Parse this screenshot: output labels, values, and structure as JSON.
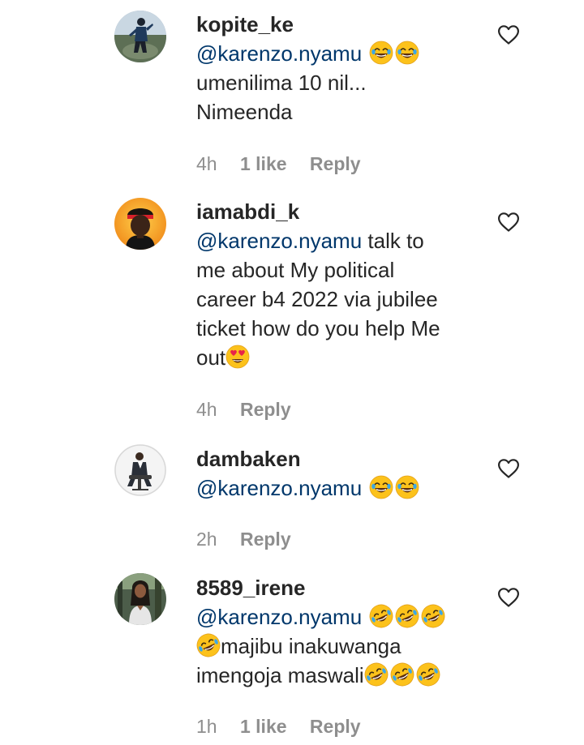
{
  "comments": [
    {
      "username": "kopite_ke",
      "mention": "@karenzo.nyamu",
      "lines": [
        "umenilima 10 nil...",
        "Nimeenda"
      ],
      "time": "4h",
      "likes": "1 like",
      "reply_label": "Reply",
      "emojis_after_mention": [
        "laughing-face-icon",
        "laughing-face-icon"
      ]
    },
    {
      "username": "iamabdi_k",
      "mention": "@karenzo.nyamu",
      "after_mention": " talk to",
      "lines": [
        "me about My political",
        "career b4 2022 via jubilee",
        "ticket how do you help Me",
        "out"
      ],
      "time": "4h",
      "reply_label": "Reply",
      "emojis_after_text": [
        "heart-eyes-face-icon"
      ]
    },
    {
      "username": "dambaken",
      "mention": "@karenzo.nyamu",
      "time": "2h",
      "reply_label": "Reply",
      "emojis_after_mention": [
        "laughing-face-icon",
        "laughing-face-icon"
      ]
    },
    {
      "username": "8589_irene",
      "mention": "@karenzo.nyamu",
      "lines": [
        "majibu inakuwanga",
        "imengoja maswali"
      ],
      "time": "1h",
      "likes": "1 like",
      "reply_label": "Reply",
      "emojis": [
        "rofl-face-icon"
      ]
    }
  ],
  "colors": {
    "text": "#262626",
    "mention": "#00376b",
    "meta": "#8e8e8e"
  }
}
